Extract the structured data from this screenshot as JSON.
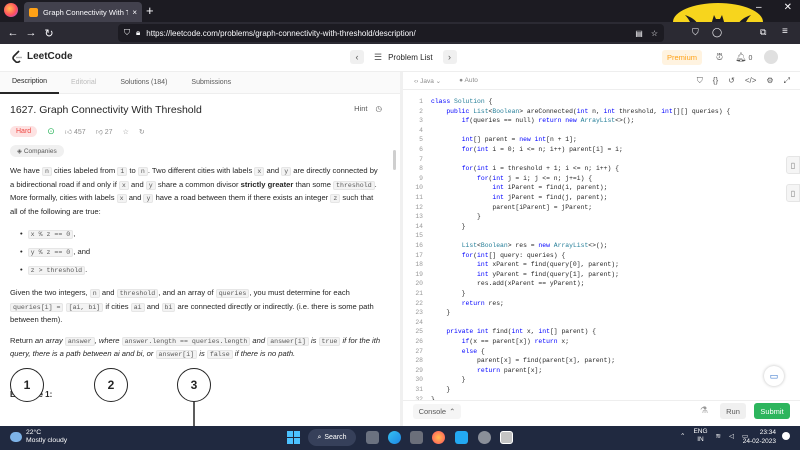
{
  "browser": {
    "tab_title": "Graph Connectivity With Thres",
    "tab_close": "×",
    "new_tab": "+",
    "url": "https://leetcode.com/problems/graph-connectivity-with-threshold/description/"
  },
  "header": {
    "logo": "LeetCode",
    "problem_list": "Problem List",
    "premium": "Premium",
    "coins": "0"
  },
  "desc_tabs": [
    "Description",
    "Editorial",
    "Solutions (184)",
    "Submissions"
  ],
  "problem": {
    "title": "1627. Graph Connectivity With Threshold",
    "hint": "Hint",
    "difficulty": "Hard",
    "likes": "457",
    "dislikes": "27",
    "companies": "Companies",
    "p1_a": "We have ",
    "p1_b": " cities labeled from ",
    "p1_c": " to ",
    "p1_d": ". Two different cities with labels ",
    "p1_e": " and ",
    "p1_f": " are directly connected by a bidirectional road if and only if ",
    "p1_g": " and ",
    "p1_h": " share a common divisor ",
    "p1_strong": "strictly greater",
    "p1_i": " than some ",
    "p1_j": ". More formally, cities with labels ",
    "p1_k": " and ",
    "p1_l": " have a road between them if there exists an integer ",
    "p1_m": " such that all of the following are true:",
    "c_n": "n",
    "c_1": "1",
    "c_x": "x",
    "c_y": "y",
    "c_threshold": "threshold",
    "c_z": "z",
    "bullets": [
      "x % z == 0",
      "y % z == 0",
      "z > threshold"
    ],
    "bullet_sep": [
      ",",
      ", and",
      "."
    ],
    "p2_a": "Given the two integers, ",
    "p2_b": " and ",
    "p2_c": ", and an array of ",
    "p2_d": ", you must determine for each ",
    "p2_e": " if cities ",
    "p2_f": " and ",
    "p2_g": " are connected directly or indirectly. (i.e. there is some path between them).",
    "c_queries": "queries",
    "c_queriesi": "queries[i] =",
    "c_ab": "[ai, bi]",
    "c_ai": "ai",
    "c_bi": "bi",
    "p3_a": "Return ",
    "p3_b": "an array ",
    "p3_c": ", where ",
    "p3_d": " and ",
    "p3_e": " is ",
    "p3_f": " if for the ",
    "p3_g": " query, there is a path between ",
    "p3_h": " and ",
    "p3_i": ", or ",
    "p3_j": " is ",
    "p3_k": " if there is no path.",
    "c_answer": "answer",
    "c_anslen": "answer.length == queries.length",
    "c_ansi": "answer[i]",
    "c_true": "true",
    "c_false": "false",
    "ith": "ith",
    "example": "Example 1:",
    "nodes": [
      "1",
      "2",
      "3"
    ]
  },
  "editor": {
    "language": "Java",
    "autosave": "Auto",
    "lines": [
      "class Solution {",
      "    public List<Boolean> areConnected(int n, int threshold, int[][] queries) {",
      "        if(queries == null) return new ArrayList<>();",
      "",
      "        int[] parent = new int[n + 1];",
      "        for(int i = 0; i <= n; i++) parent[i] = i;",
      "",
      "        for(int i = threshold + 1; i <= n; i++) {",
      "            for(int j = i; j <= n; j+=i) {",
      "                int iParent = find(i, parent);",
      "                int jParent = find(j, parent);",
      "                parent[iParent] = jParent;",
      "            }",
      "        }",
      "",
      "        List<Boolean> res = new ArrayList<>();",
      "        for(int[] query: queries) {",
      "            int xParent = find(query[0], parent);",
      "            int yParent = find(query[1], parent);",
      "            res.add(xParent == yParent);",
      "        }",
      "        return res;",
      "    }",
      "",
      "    private int find(int x, int[] parent) {",
      "        if(x == parent[x]) return x;",
      "        else {",
      "            parent[x] = find(parent[x], parent);",
      "            return parent[x];",
      "        }",
      "    }",
      "}"
    ],
    "console": "Console",
    "run": "Run",
    "submit": "Submit"
  },
  "taskbar": {
    "temp": "22°C",
    "weather": "Mostly cloudy",
    "search": "Search",
    "lang": "ENG",
    "region": "IN",
    "time": "23:34",
    "date": "24-02-2023"
  }
}
